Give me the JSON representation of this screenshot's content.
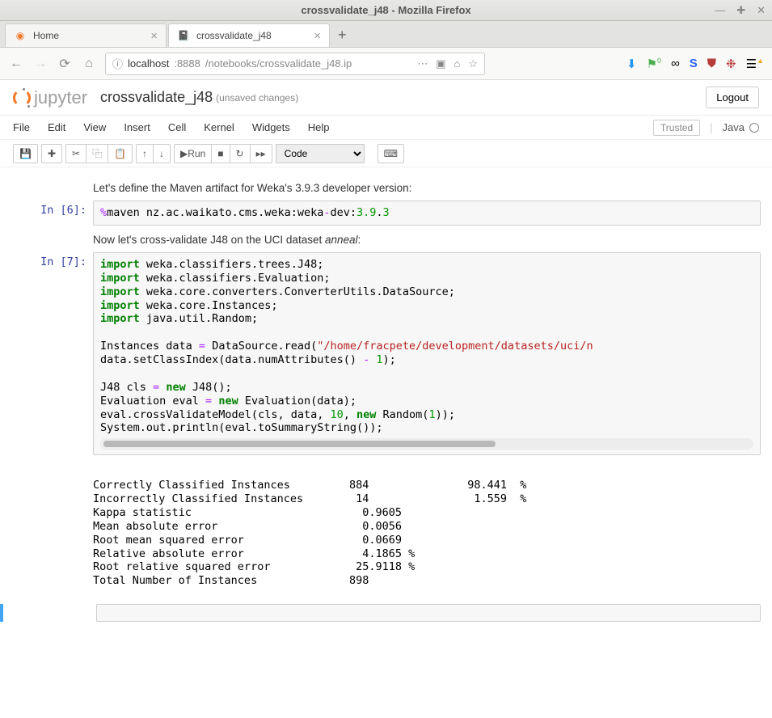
{
  "window": {
    "title": "crossvalidate_j48 - Mozilla Firefox"
  },
  "tabs": [
    {
      "label": "Home",
      "active": false
    },
    {
      "label": "crossvalidate_j48",
      "active": true
    }
  ],
  "url": {
    "scheme": "localhost",
    "port": ":8888",
    "path": "/notebooks/crossvalidate_j48.ip"
  },
  "header": {
    "brand": "jupyter",
    "notebook_name": "crossvalidate_j48",
    "unsaved": "(unsaved changes)",
    "logout": "Logout"
  },
  "menu": {
    "items": [
      "File",
      "Edit",
      "View",
      "Insert",
      "Cell",
      "Kernel",
      "Widgets",
      "Help"
    ],
    "trusted": "Trusted",
    "kernel": "Java"
  },
  "toolbar": {
    "run_label": "Run",
    "celltype": "Code"
  },
  "md1": "Let's define the Maven artifact for Weka's 3.9.3 developer version:",
  "prompt6": "In [6]:",
  "code6": {
    "line1_a": "%",
    "line1_b": "maven nz.ac.waikato.cms.weka:weka",
    "line1_c": "-",
    "line1_d": "dev:",
    "line1_e": "3.9",
    ".": "",
    "line1_f": ".",
    "line1_g": "3"
  },
  "md2_a": "Now let's cross-validate J48 on the UCI dataset ",
  "md2_b": "anneal",
  "md2_c": ":",
  "prompt7": "In [7]:",
  "code7": {
    "l1a": "import",
    "l1b": " weka.classifiers.trees.J48;",
    "l2a": "import",
    "l2b": " weka.classifiers.Evaluation;",
    "l3a": "import",
    "l3b": " weka.core.converters.ConverterUtils.DataSource;",
    "l4a": "import",
    "l4b": " weka.core.Instances;",
    "l5a": "import",
    "l5b": " java.util.Random;",
    "l7a": "Instances data ",
    "l7b": "=",
    "l7c": " DataSource.read(",
    "l7d": "\"/home/fracpete/development/datasets/uci/n",
    "l7e": "",
    "l8a": "data.setClassIndex(data.numAttributes() ",
    "l8b": "-",
    "l8c": " ",
    "l8d": "1",
    "l8e": ");",
    "l10a": "J48 cls ",
    "l10b": "=",
    "l10c": " ",
    "l10d": "new",
    "l10e": " J48();",
    "l11a": "Evaluation eval ",
    "l11b": "=",
    "l11c": " ",
    "l11d": "new",
    "l11e": " Evaluation(data);",
    "l12a": "eval.crossValidateModel(cls, data, ",
    "l12b": "10",
    "l12c": ", ",
    "l12d": "new",
    "l12e": " Random(",
    "l12f": "1",
    "l12g": "));",
    "l13": "System.out.println(eval.toSummaryString());"
  },
  "output7": "\nCorrectly Classified Instances         884               98.441  %\nIncorrectly Classified Instances        14                1.559  %\nKappa statistic                          0.9605\nMean absolute error                      0.0056\nRoot mean squared error                  0.0669\nRelative absolute error                  4.1865 %\nRoot relative squared error             25.9118 %\nTotal Number of Instances              898     "
}
